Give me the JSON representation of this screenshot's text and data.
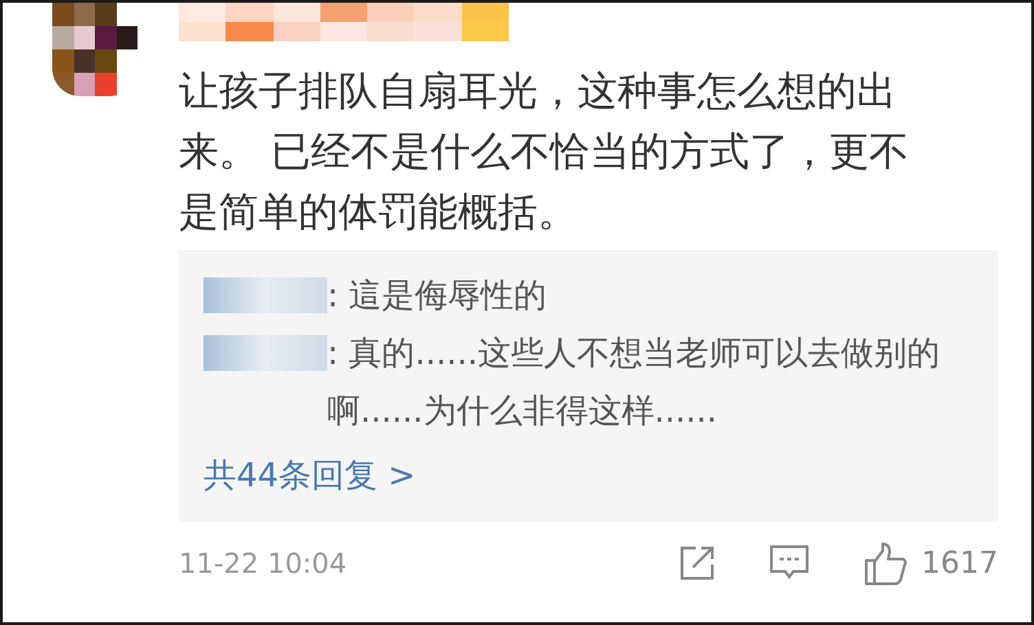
{
  "comment": {
    "text": "让孩子排队自扇耳光，这种事怎么想的出来。 已经不是什么不恰当的方式了，更不是简单的体罚能概括。",
    "replies": [
      {
        "text": ": 這是侮辱性的"
      },
      {
        "text": ": 真的......这些人不想当老师可以去做别的啊......为什么非得这样......"
      }
    ],
    "more_replies": "共44条回复 >",
    "time": "11-22 10:04",
    "likes": "1617"
  }
}
